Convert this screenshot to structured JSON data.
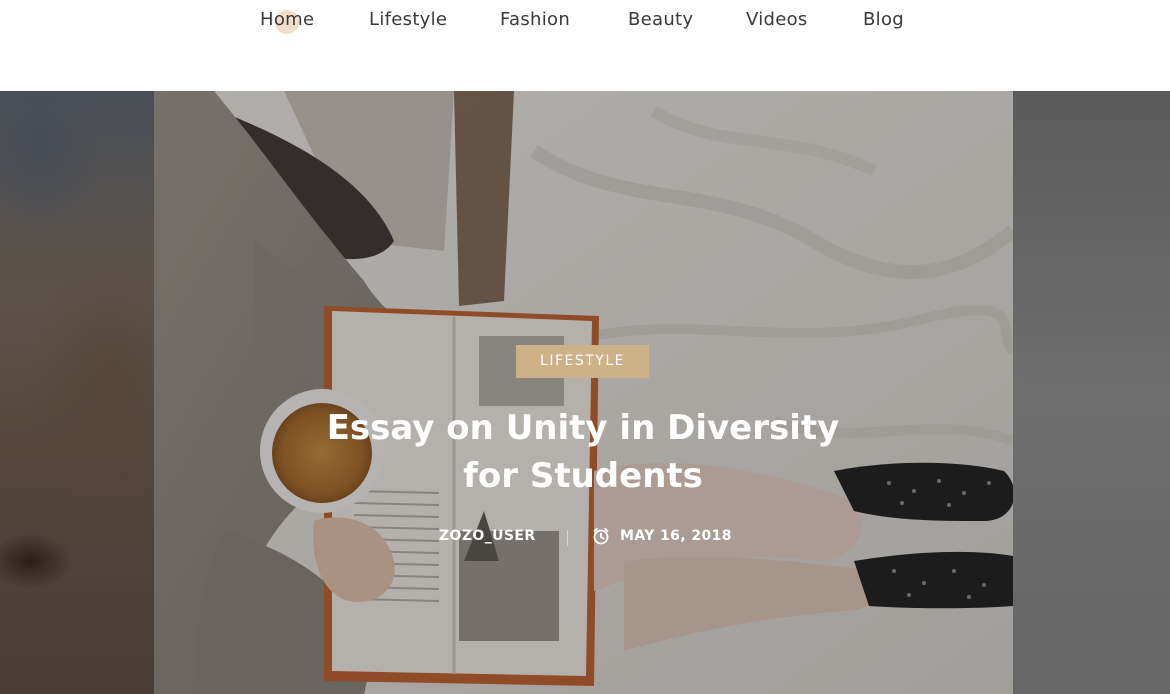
{
  "nav": {
    "items": [
      {
        "label": "Home"
      },
      {
        "label": "Lifestyle"
      },
      {
        "label": "Fashion"
      },
      {
        "label": "Beauty"
      },
      {
        "label": "Videos"
      },
      {
        "label": "Blog"
      }
    ],
    "active_index": 0
  },
  "slide": {
    "category": "LIFESTYLE",
    "title_line1": "Essay on Unity in Diversity",
    "title_line2": "for Students",
    "author": "ZOZO_USER",
    "date": "MAY 16, 2018",
    "date_icon": "clock-icon"
  },
  "colors": {
    "badge": "#cdb187",
    "nav_active_dot": "#ecd8bf",
    "nav_text": "#3a3a3a"
  }
}
